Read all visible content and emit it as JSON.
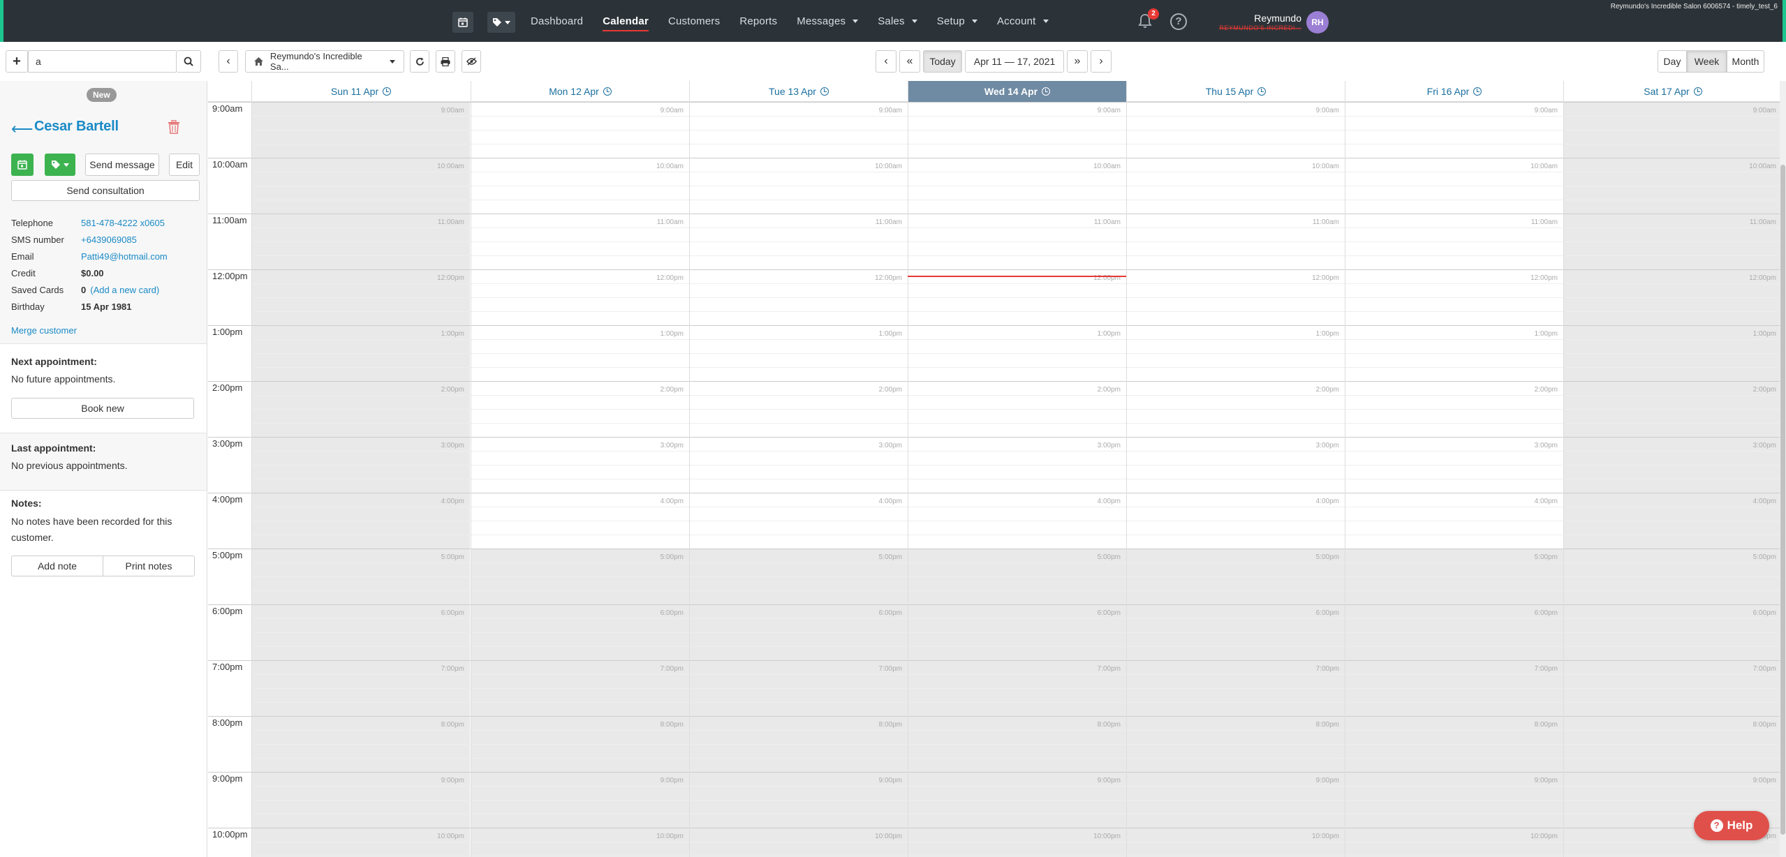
{
  "env_label": "Reymundo's Incredible Salon 6006574 - timely_test_6",
  "colors": {
    "accent": "#1ec68f",
    "brand_blue": "#1a8ac6",
    "green": "#3db350",
    "avatar": "#9b7fd4",
    "today_header": "#6f8aa3",
    "now_line": "#e53935"
  },
  "nav": {
    "links": [
      {
        "label": "Dashboard",
        "active": false,
        "dropdown": false
      },
      {
        "label": "Calendar",
        "active": true,
        "dropdown": false
      },
      {
        "label": "Customers",
        "active": false,
        "dropdown": false
      },
      {
        "label": "Reports",
        "active": false,
        "dropdown": false
      },
      {
        "label": "Messages",
        "active": false,
        "dropdown": true
      },
      {
        "label": "Sales",
        "active": false,
        "dropdown": true
      },
      {
        "label": "Setup",
        "active": false,
        "dropdown": true
      },
      {
        "label": "Account",
        "active": false,
        "dropdown": true
      }
    ],
    "notification_count": "2",
    "user_name": "Reymundo",
    "user_salon": "REYMUNDO'S INCREDI...",
    "user_initials": "RH"
  },
  "toolbar": {
    "search_value": "a",
    "location_label": "Reymundo's Incredible Sa...",
    "today_label": "Today",
    "date_range": "Apr 11 — 17, 2021",
    "views": [
      "Day",
      "Week",
      "Month"
    ],
    "active_view": "Week"
  },
  "customer": {
    "badge": "New",
    "name": "Cesar Bartell",
    "send_message_label": "Send message",
    "edit_label": "Edit",
    "send_consultation_label": "Send consultation",
    "details": [
      {
        "label": "Telephone",
        "value": "581-478-4222 x0605",
        "link": true
      },
      {
        "label": "SMS number",
        "value": "+6439069085",
        "link": true
      },
      {
        "label": "Email",
        "value": "Patti49@hotmail.com",
        "link": true
      },
      {
        "label": "Credit",
        "value": "$0.00",
        "link": false
      },
      {
        "label": "Saved Cards",
        "value": "0",
        "extra": "(Add a new card)",
        "link": false
      },
      {
        "label": "Birthday",
        "value": "15 Apr 1981",
        "link": false
      }
    ],
    "merge_label": "Merge customer",
    "next_title": "Next appointment:",
    "next_text": "No future appointments.",
    "book_new_label": "Book new",
    "last_title": "Last appointment:",
    "last_text": "No previous appointments.",
    "notes_title": "Notes:",
    "notes_text": "No notes have been recorded for this customer.",
    "add_note_label": "Add note",
    "print_notes_label": "Print notes"
  },
  "calendar": {
    "days": [
      {
        "label": "Sun 11 Apr",
        "today": false,
        "closed": true
      },
      {
        "label": "Mon 12 Apr",
        "today": false,
        "closed": false
      },
      {
        "label": "Tue 13 Apr",
        "today": false,
        "closed": false
      },
      {
        "label": "Wed 14 Apr",
        "today": true,
        "closed": false
      },
      {
        "label": "Thu 15 Apr",
        "today": false,
        "closed": false
      },
      {
        "label": "Fri 16 Apr",
        "today": false,
        "closed": false
      },
      {
        "label": "Sat 17 Apr",
        "today": false,
        "closed": true
      }
    ],
    "hours": [
      "9:00am",
      "10:00am",
      "11:00am",
      "12:00pm",
      "1:00pm",
      "2:00pm",
      "3:00pm",
      "4:00pm",
      "5:00pm",
      "6:00pm",
      "7:00pm",
      "8:00pm",
      "9:00pm",
      "10:00pm"
    ],
    "open_hours": 8,
    "now_time": "12:00pm"
  },
  "help_label": "Help"
}
